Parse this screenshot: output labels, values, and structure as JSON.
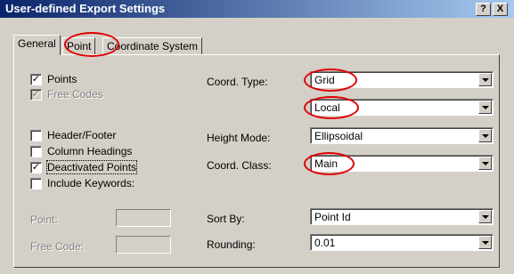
{
  "window": {
    "title": "User-defined Export Settings",
    "help_label": "?",
    "close_label": "X"
  },
  "tabs": [
    {
      "label": "General",
      "active": true
    },
    {
      "label": "Point",
      "active": false
    },
    {
      "label": "Coordinate System",
      "active": false
    }
  ],
  "checkboxes": [
    {
      "label": "Points",
      "checked": true,
      "mark": "✓",
      "enabled": true
    },
    {
      "label": "Free Codes",
      "checked": true,
      "mark": "✓",
      "enabled": false
    },
    {
      "label": "Header/Footer",
      "checked": false,
      "mark": "",
      "enabled": true
    },
    {
      "label": "Column Headings",
      "checked": false,
      "mark": "",
      "enabled": true
    },
    {
      "label": "Deactivated Points",
      "checked": true,
      "mark": "✓",
      "enabled": true
    },
    {
      "label": "Include Keywords:",
      "checked": false,
      "mark": "",
      "enabled": true
    }
  ],
  "fields": {
    "point": {
      "label": "Point:"
    },
    "free_code": {
      "label": "Free Code:"
    }
  },
  "settings": {
    "coord_type": {
      "label": "Coord. Type:",
      "value": "Grid"
    },
    "coord_type_2": {
      "value": "Local"
    },
    "height_mode": {
      "label": "Height Mode:",
      "value": "Ellipsoidal"
    },
    "coord_class": {
      "label": "Coord. Class:",
      "value": "Main"
    },
    "sort_by": {
      "label": "Sort By:",
      "value": "Point Id"
    },
    "rounding": {
      "label": "Rounding:",
      "value": "0.01"
    }
  },
  "colors": {
    "annotation": "#e00000",
    "title_bar": "#0a246a"
  }
}
